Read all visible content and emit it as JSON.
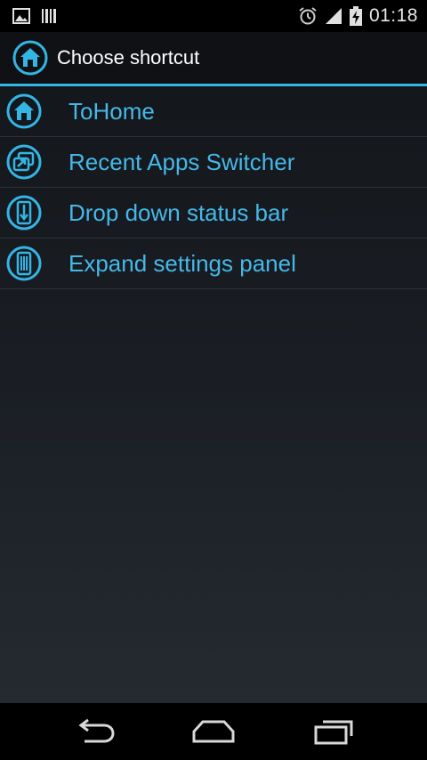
{
  "status_bar": {
    "time": "01:18",
    "icons": [
      "picture-icon",
      "barcode-icon",
      "alarm-icon",
      "signal-icon",
      "battery-icon"
    ]
  },
  "action_bar": {
    "title": "Choose shortcut",
    "icon": "home-icon"
  },
  "list": {
    "items": [
      {
        "label": "ToHome",
        "icon": "home-icon"
      },
      {
        "label": "Recent Apps Switcher",
        "icon": "recent-apps-icon"
      },
      {
        "label": "Drop down status bar",
        "icon": "drop-down-icon"
      },
      {
        "label": "Expand settings panel",
        "icon": "expand-panel-icon"
      }
    ]
  },
  "nav_bar": {
    "buttons": [
      "back-icon",
      "home-nav-icon",
      "recents-icon"
    ]
  },
  "colors": {
    "accent": "#33b5e5",
    "item_text": "#45b8e8",
    "title_text": "#ffffff",
    "status_bar_bg": "#000000",
    "action_bar_bg": "#0f1114"
  }
}
